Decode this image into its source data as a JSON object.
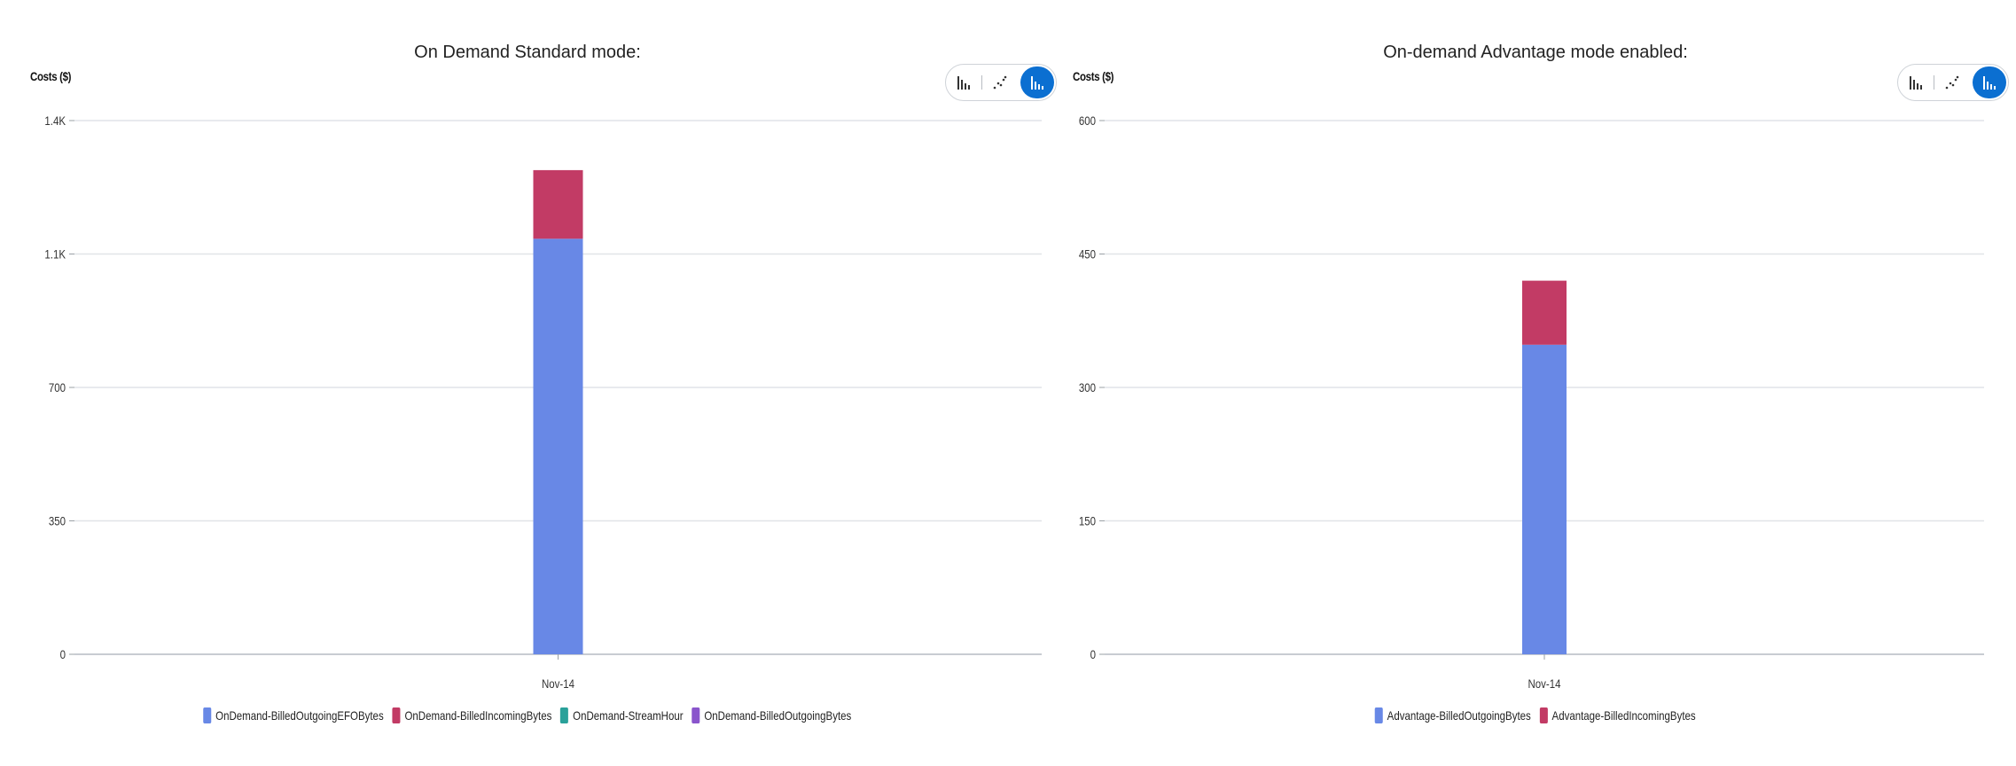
{
  "chart_data": [
    {
      "type": "bar",
      "stacked": true,
      "title": "On Demand Standard mode:",
      "ylabel": "Costs ($)",
      "xlabel": "",
      "categories": [
        "Nov-14"
      ],
      "yticks": [
        0,
        350,
        700,
        1050,
        1400
      ],
      "ytick_labels": [
        "0",
        "350",
        "700",
        "1.1K",
        "1.4K"
      ],
      "ylim": [
        0,
        1400
      ],
      "grid": true,
      "legend_position": "bottom",
      "series": [
        {
          "name": "OnDemand-BilledOutgoingEFOBytes",
          "values": [
            1090
          ],
          "color": "#6888e6"
        },
        {
          "name": "OnDemand-BilledIncomingBytes",
          "values": [
            180
          ],
          "color": "#c23b65"
        },
        {
          "name": "OnDemand-StreamHour",
          "values": [
            0
          ],
          "color": "#2aa19a"
        },
        {
          "name": "OnDemand-BilledOutgoingBytes",
          "values": [
            0
          ],
          "color": "#8a55cc"
        }
      ],
      "toggles": [
        {
          "icon": "bar-chart-icon",
          "active": false
        },
        {
          "icon": "scatter-chart-icon",
          "active": false
        },
        {
          "icon": "stacked-bar-chart-icon",
          "active": true
        }
      ]
    },
    {
      "type": "bar",
      "stacked": true,
      "title": "On-demand Advantage mode enabled:",
      "ylabel": "Costs ($)",
      "xlabel": "",
      "categories": [
        "Nov-14"
      ],
      "yticks": [
        0,
        150,
        300,
        450,
        600
      ],
      "ytick_labels": [
        "0",
        "150",
        "300",
        "450",
        "600"
      ],
      "ylim": [
        0,
        600
      ],
      "grid": true,
      "legend_position": "bottom",
      "series": [
        {
          "name": "Advantage-BilledOutgoingBytes",
          "values": [
            348
          ],
          "color": "#6888e6"
        },
        {
          "name": "Advantage-BilledIncomingBytes",
          "values": [
            72
          ],
          "color": "#c23b65"
        }
      ],
      "toggles": [
        {
          "icon": "bar-chart-icon",
          "active": false
        },
        {
          "icon": "scatter-chart-icon",
          "active": false
        },
        {
          "icon": "stacked-bar-chart-icon",
          "active": true
        }
      ]
    }
  ]
}
